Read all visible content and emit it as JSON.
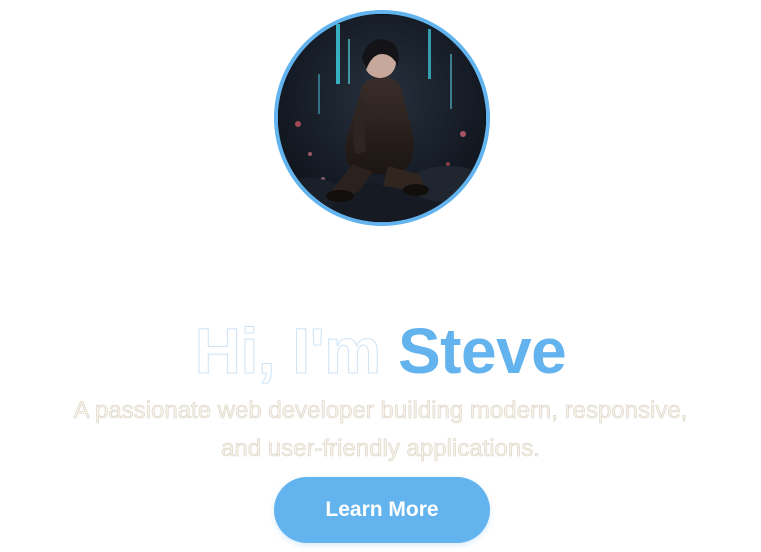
{
  "profile": {
    "avatar_icon": "avatar-portrait-image",
    "avatar_border_color": "#62b3ee"
  },
  "hero": {
    "greeting": "Hi, I'm ",
    "name": "Steve",
    "subtitle_line1": "A passionate web developer building modern, responsive,",
    "subtitle_line2": "and user-friendly applications.",
    "cta_label": "Learn More"
  },
  "colors": {
    "accent": "#62b3ee",
    "background": "#ffffff"
  }
}
